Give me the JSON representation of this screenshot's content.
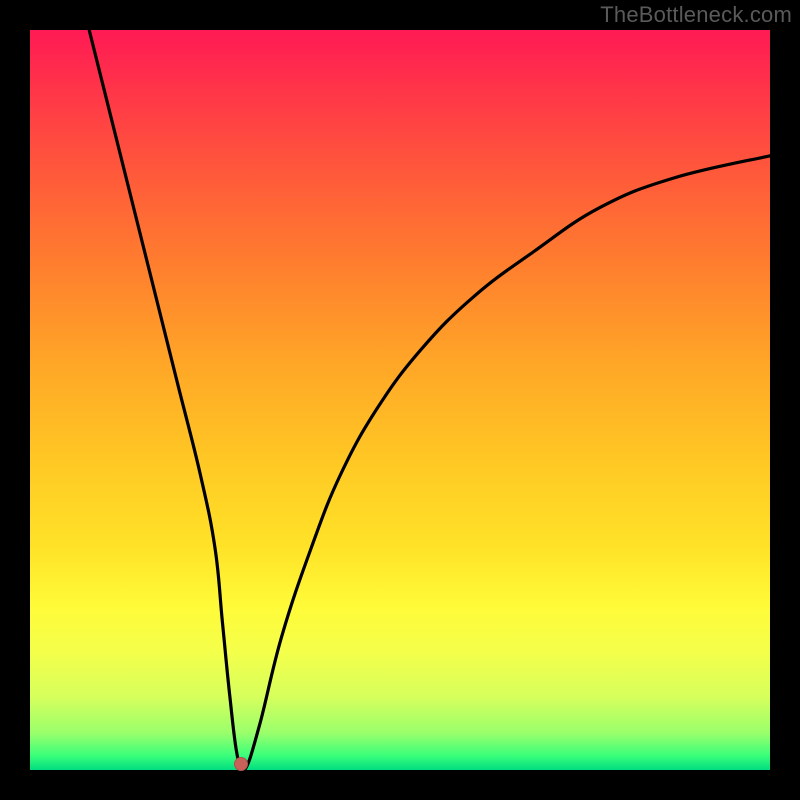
{
  "attribution": "TheBottleneck.com",
  "chart_data": {
    "type": "line",
    "title": "",
    "xlabel": "",
    "ylabel": "",
    "xlim": [
      0,
      100
    ],
    "ylim": [
      0,
      100
    ],
    "grid": false,
    "series": [
      {
        "name": "curve",
        "x": [
          8,
          11,
          14,
          17,
          20,
          23,
          25,
          26,
          27,
          28,
          29,
          31,
          34,
          38,
          42,
          47,
          53,
          60,
          68,
          77,
          87,
          100
        ],
        "y": [
          100,
          88,
          76,
          64,
          52,
          40,
          30,
          20,
          10,
          2,
          0,
          6,
          18,
          30,
          40,
          49,
          57,
          64,
          70,
          76,
          80,
          83
        ]
      }
    ],
    "marker": {
      "x": 28.5,
      "y": 0.8
    },
    "colors": {
      "curve_stroke": "#000000",
      "marker_fill": "#c9615b",
      "gradient_top": "#ff1a54",
      "gradient_bottom": "#00dd80"
    }
  }
}
